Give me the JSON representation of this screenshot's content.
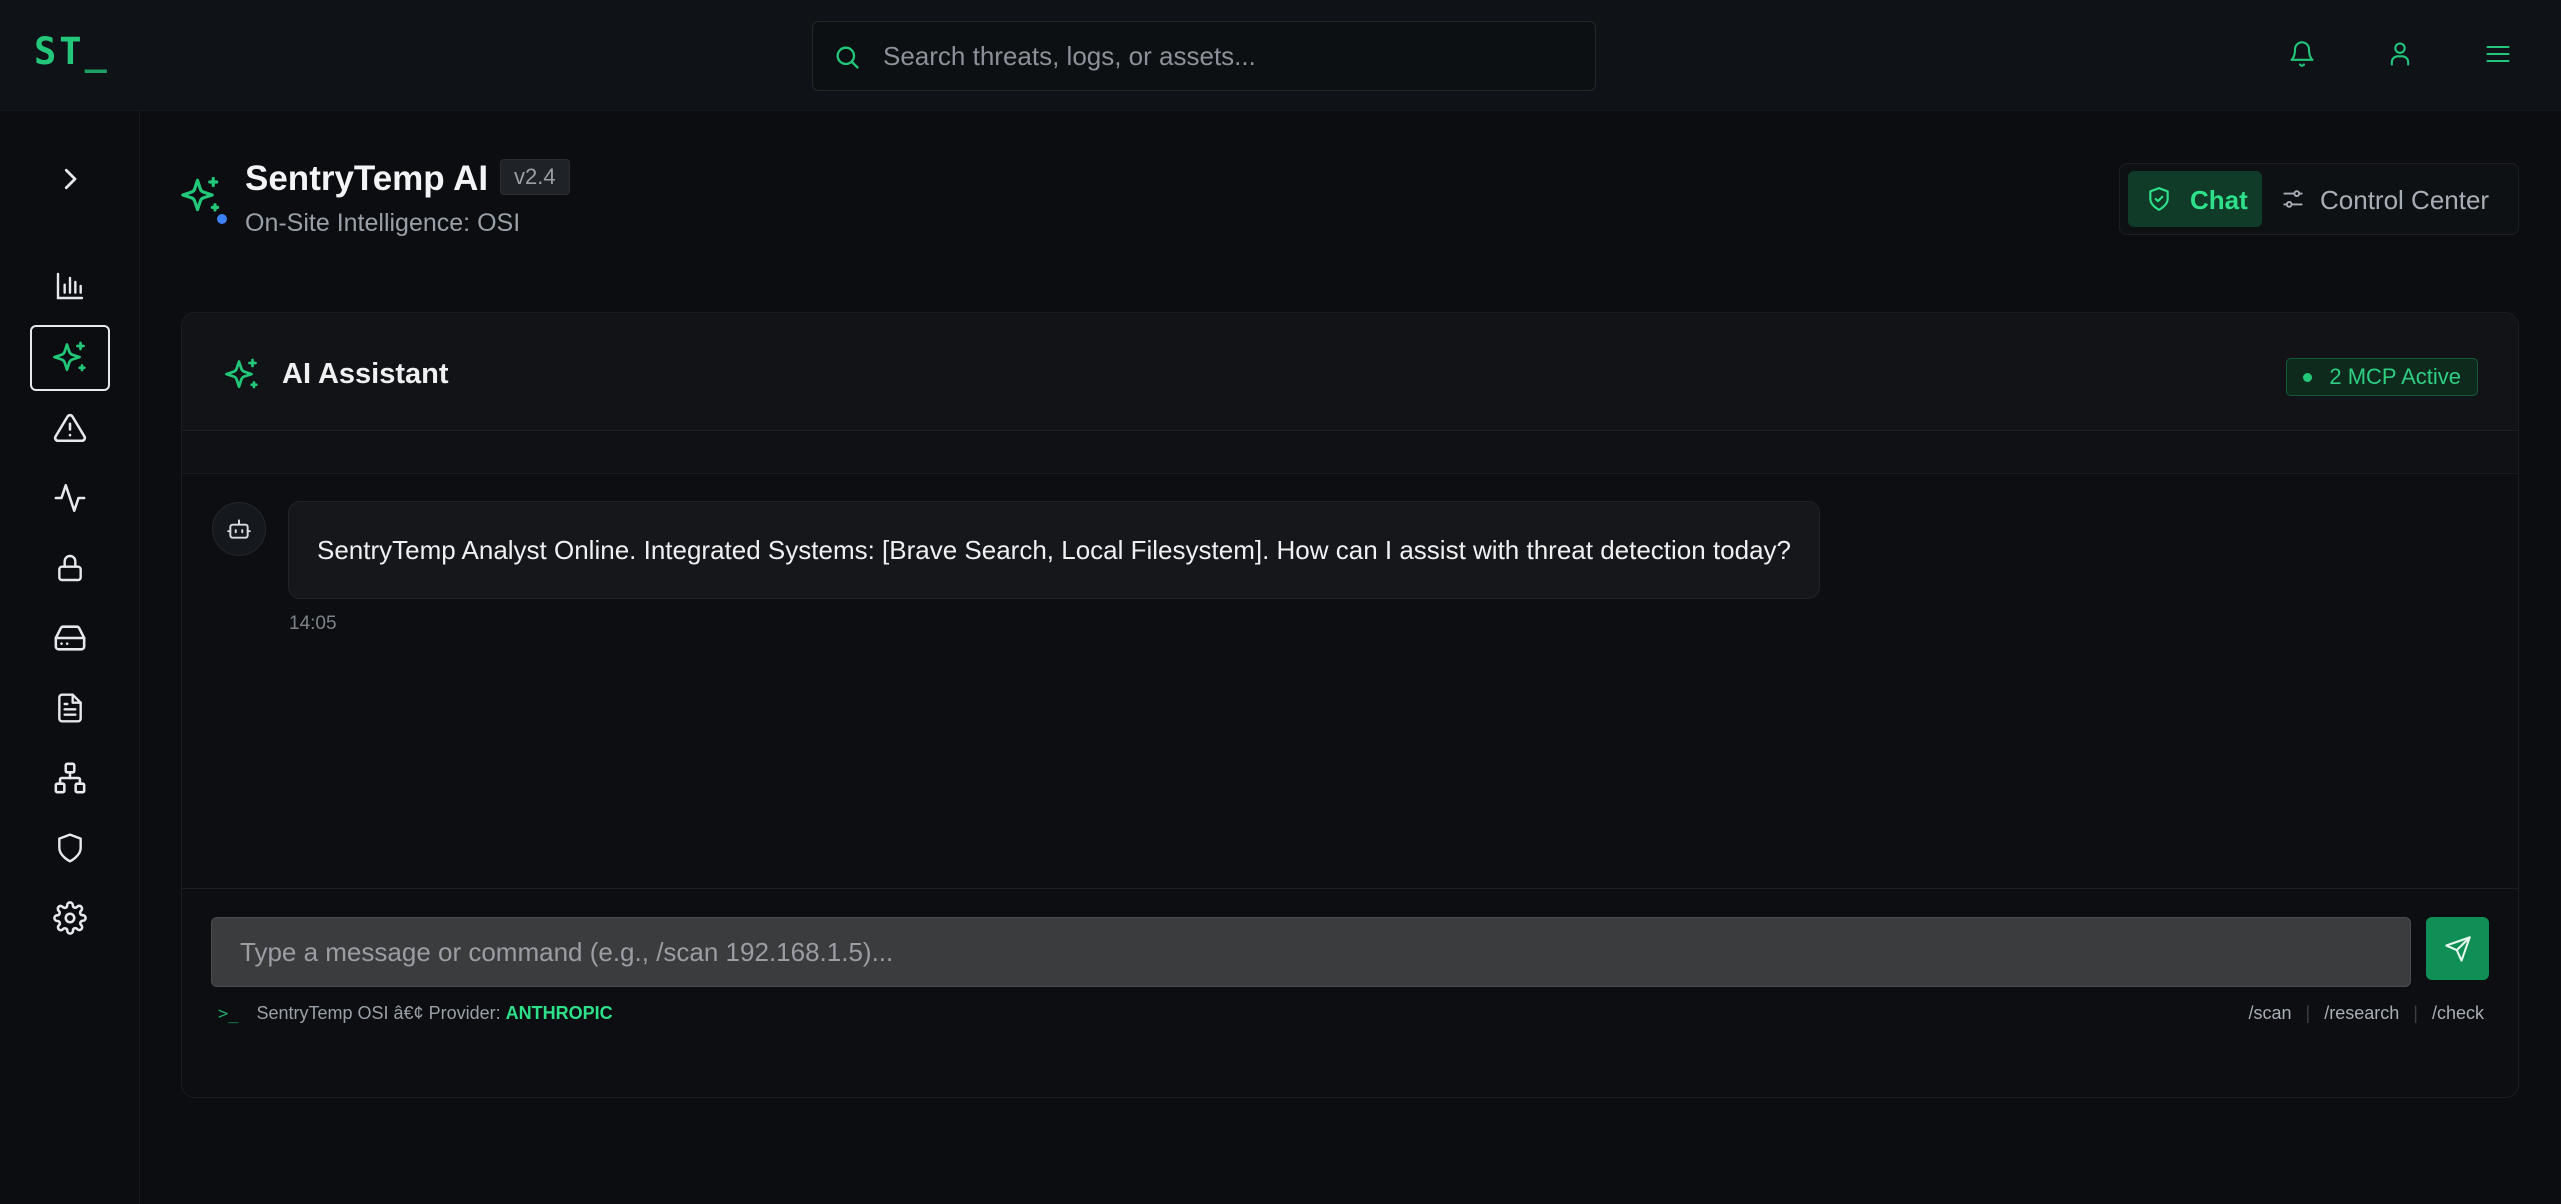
{
  "app": {
    "logo": "ST",
    "logo_cursor": "_",
    "accent_color": "#22c77a"
  },
  "search": {
    "placeholder": "Search threats, logs, or assets..."
  },
  "top_actions": {
    "icons": [
      "bell-icon",
      "user-icon",
      "menu-icon"
    ]
  },
  "sidebar": {
    "items": [
      {
        "icon": "chevron-right-icon"
      },
      {
        "icon": "bar-chart-icon"
      },
      {
        "icon": "sparkles-icon",
        "active": true
      },
      {
        "icon": "alert-triangle-icon"
      },
      {
        "icon": "activity-icon"
      },
      {
        "icon": "lock-icon"
      },
      {
        "icon": "hard-drive-icon"
      },
      {
        "icon": "file-text-icon"
      },
      {
        "icon": "network-icon"
      },
      {
        "icon": "shield-icon"
      },
      {
        "icon": "settings-icon"
      }
    ]
  },
  "header": {
    "title": "SentryTemp AI",
    "version": "v2.4",
    "subtitle": "On-Site Intelligence: OSI",
    "status_color": "#3b82f6"
  },
  "view_toggle": {
    "chat_label": "Chat",
    "control_center_label": "Control Center",
    "active": "Chat"
  },
  "assistant": {
    "title": "AI Assistant",
    "mcp_badge": "2 MCP Active",
    "messages": [
      {
        "sender": "bot",
        "text": "SentryTemp Analyst Online. Integrated Systems: [Brave Search, Local Filesystem]. How can I assist with threat detection today?",
        "time": "14:05"
      }
    ],
    "composer_placeholder": "Type a message or command (e.g., /scan 192.168.1.5)...",
    "footer_prompt": ">_",
    "footer_prefix": "SentryTemp OSI â€¢ Provider:",
    "provider": "ANTHROPIC",
    "quick_commands": [
      "/scan",
      "/research",
      "/check"
    ]
  }
}
